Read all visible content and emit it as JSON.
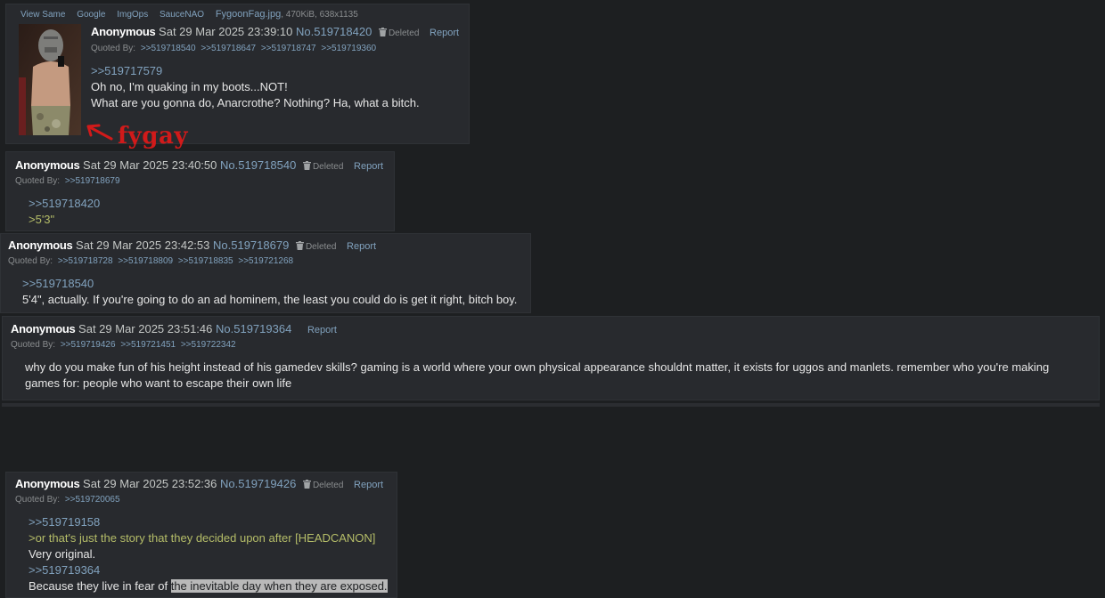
{
  "post1": {
    "file_links": [
      "View Same",
      "Google",
      "ImgOps",
      "SauceNAO"
    ],
    "file_name": "FygoonFag.jpg",
    "file_info": ", 470KiB, 638x1135",
    "name": "Anonymous",
    "date": "Sat 29 Mar 2025 23:39:10",
    "number": "No.519718420",
    "deleted": "Deleted",
    "report": "Report",
    "quoted_by_label": "Quoted By:",
    "quoted_by": [
      ">>519718540",
      ">>519718647",
      ">>519718747",
      ">>519719360"
    ],
    "quote": ">>519717579",
    "lines": [
      "Oh no, I'm quaking in my boots...NOT!",
      "What are you gonna do, Anarcrothe? Nothing? Ha, what a bitch."
    ],
    "annotation": "fygay"
  },
  "post2": {
    "name": "Anonymous",
    "date": "Sat 29 Mar 2025 23:40:50",
    "number": "No.519718540",
    "deleted": "Deleted",
    "report": "Report",
    "quoted_by_label": "Quoted By:",
    "quoted_by": [
      ">>519718679"
    ],
    "quote": ">>519718420",
    "greentext": ">5'3\""
  },
  "post3": {
    "name": "Anonymous",
    "date": "Sat 29 Mar 2025 23:42:53",
    "number": "No.519718679",
    "deleted": "Deleted",
    "report": "Report",
    "quoted_by_label": "Quoted By:",
    "quoted_by": [
      ">>519718728",
      ">>519718809",
      ">>519718835",
      ">>519721268"
    ],
    "quote": ">>519718540",
    "line": "5'4\", actually. If you're going to do an ad hominem, the least you could do is get it right, bitch boy."
  },
  "post4": {
    "name": "Anonymous",
    "date": "Sat 29 Mar 2025 23:51:46",
    "number": "No.519719364",
    "report": "Report",
    "quoted_by_label": "Quoted By:",
    "quoted_by": [
      ">>519719426",
      ">>519721451",
      ">>519722342"
    ],
    "lines": [
      "why do you make fun of his height instead of his gamedev skills? gaming is a world where your own physical appearance shouldnt matter, it exists for uggos and manlets. remember who you're making",
      "games for: people who want to escape their own life"
    ]
  },
  "post5": {
    "name": "Anonymous",
    "date": "Sat 29 Mar 2025 23:52:36",
    "number": "No.519719426",
    "deleted": "Deleted",
    "report": "Report",
    "quoted_by_label": "Quoted By:",
    "quoted_by": [
      ">>519720065"
    ],
    "quote1": ">>519719158",
    "greentext": ">or that's just the story that they decided upon after [HEADCANON]",
    "line1": "Very original.",
    "quote2": ">>519719364",
    "line2_plain": "Because they live in fear of ",
    "line2_highlight": "the inevitable day when they are exposed."
  }
}
